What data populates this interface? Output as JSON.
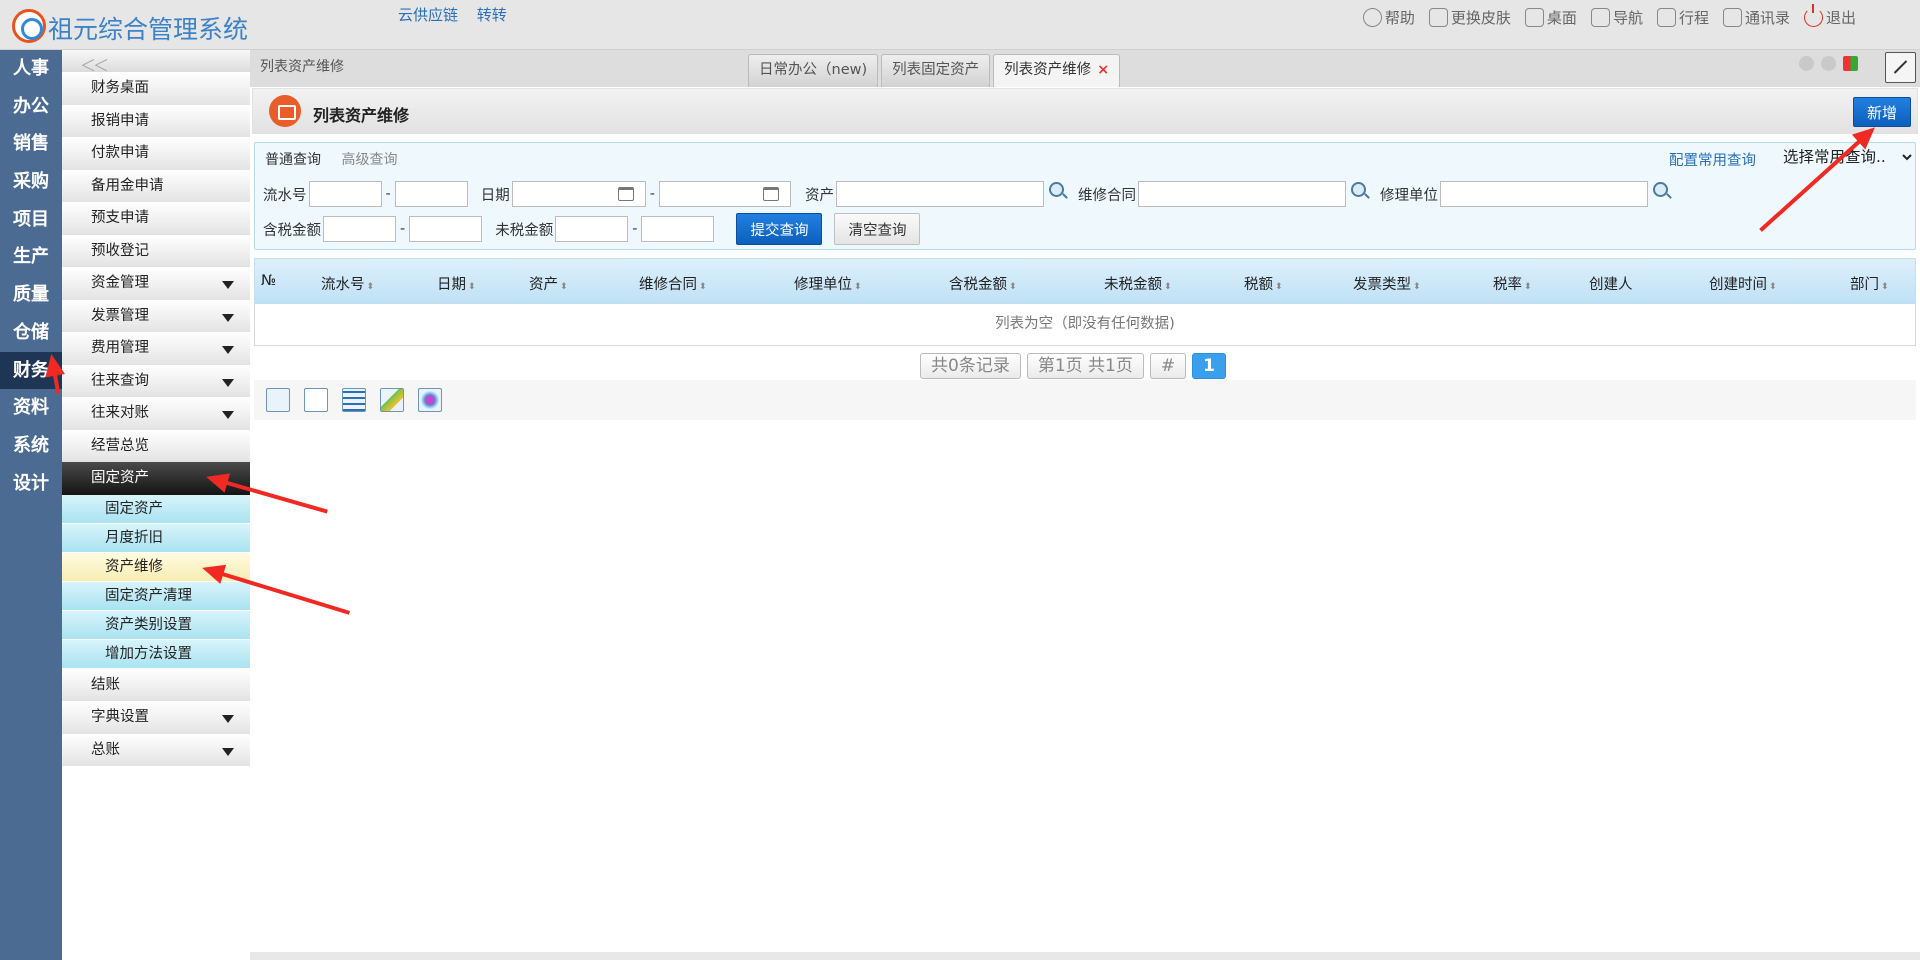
{
  "app": {
    "title": "祖元综合管理系统",
    "top_links": [
      "云供应链",
      "转转"
    ],
    "top_actions": [
      {
        "label": "帮助",
        "icon": "help-icon"
      },
      {
        "label": "更换皮肤",
        "icon": "shirt-icon"
      },
      {
        "label": "桌面",
        "icon": "home-icon"
      },
      {
        "label": "导航",
        "icon": "grid-icon"
      },
      {
        "label": "行程",
        "icon": "calendar-icon"
      },
      {
        "label": "通讯录",
        "icon": "contacts-icon"
      },
      {
        "label": "退出",
        "icon": "power-icon"
      }
    ]
  },
  "modules": [
    "人事",
    "办公",
    "销售",
    "采购",
    "项目",
    "生产",
    "质量",
    "仓储",
    "财务",
    "资料",
    "系统",
    "设计"
  ],
  "active_module": "财务",
  "subnav": {
    "collapse_glyph": "＜＜",
    "items": [
      {
        "label": "财务桌面"
      },
      {
        "label": "报销申请"
      },
      {
        "label": "付款申请"
      },
      {
        "label": "备用金申请"
      },
      {
        "label": "预支申请"
      },
      {
        "label": "预收登记"
      },
      {
        "label": "资金管理",
        "expandable": true
      },
      {
        "label": "发票管理",
        "expandable": true
      },
      {
        "label": "费用管理",
        "expandable": true
      },
      {
        "label": "往来查询",
        "expandable": true
      },
      {
        "label": "往来对账",
        "expandable": true
      },
      {
        "label": "经营总览"
      },
      {
        "label": "固定资产",
        "expanded": true
      }
    ],
    "children": [
      "固定资产",
      "月度折旧",
      "资产维修",
      "固定资产清理",
      "资产类别设置",
      "增加方法设置"
    ],
    "selected_child": "资产维修",
    "tail_items": [
      {
        "label": "结账"
      },
      {
        "label": "字典设置",
        "expandable": true
      },
      {
        "label": "总账",
        "expandable": true
      }
    ]
  },
  "tabstrip": {
    "breadcrumb": "列表资产维修",
    "tabs": [
      {
        "label": "日常办公（new)"
      },
      {
        "label": "列表固定资产"
      },
      {
        "label": "列表资产维修",
        "active": true,
        "close": "×"
      }
    ]
  },
  "page": {
    "title": "列表资产维修",
    "add_button": "新增"
  },
  "search": {
    "tab_normal": "普通查询",
    "tab_advanced": "高级查询",
    "config_link": "配置常用查询",
    "saved_query_selected": "选择常用查询..",
    "dash": "-",
    "labels": {
      "serial": "流水号",
      "date": "日期",
      "asset": "资产",
      "contract": "维修合同",
      "repair_unit": "修理单位",
      "taxed_amount": "含税金额",
      "untaxed_amount": "未税金额"
    },
    "submit": "提交查询",
    "clear": "清空查询"
  },
  "table": {
    "columns": [
      {
        "label": "№",
        "sortable": false
      },
      {
        "label": "流水号",
        "sortable": true
      },
      {
        "label": "日期",
        "sortable": true
      },
      {
        "label": "资产",
        "sortable": true
      },
      {
        "label": "维修合同",
        "sortable": true
      },
      {
        "label": "修理单位",
        "sortable": true
      },
      {
        "label": "含税金额",
        "sortable": true
      },
      {
        "label": "未税金额",
        "sortable": true
      },
      {
        "label": "税额",
        "sortable": true
      },
      {
        "label": "发票类型",
        "sortable": true
      },
      {
        "label": "税率",
        "sortable": true
      },
      {
        "label": "创建人",
        "sortable": false
      },
      {
        "label": "创建时间",
        "sortable": true
      },
      {
        "label": "部门",
        "sortable": true
      }
    ],
    "sort_glyph": "⬍",
    "empty_text": "列表为空（即没有任何数据)"
  },
  "pager": {
    "records": "共0条记录",
    "pages": "第1页 共1页",
    "hash": "#",
    "current": "1"
  },
  "toolbar_icons": [
    "select-icon",
    "document-icon",
    "table-icon",
    "edit-icon",
    "puzzle-icon"
  ],
  "colors": {
    "module_bar": "#4b6b93",
    "module_active": "#1f3556",
    "primary_button": "#0c5fbd",
    "annotation_arrow": "#f02a22"
  }
}
